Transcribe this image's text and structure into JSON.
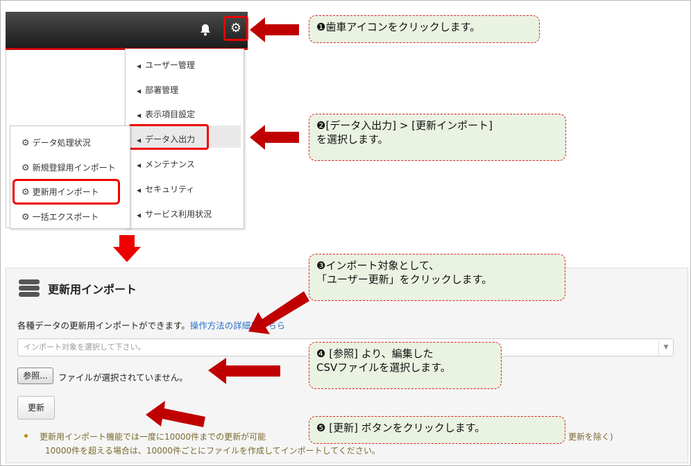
{
  "menu": {
    "items": [
      "ユーザー管理",
      "部署管理",
      "表示項目設定",
      "データ入出力",
      "メンテナンス",
      "セキュリティ",
      "サービス利用状況"
    ]
  },
  "submenu": {
    "items": [
      "データ処理状況",
      "新規登録用インポート",
      "更新用インポート",
      "一括エクスポート"
    ]
  },
  "callouts": {
    "c1": "❶歯車アイコンをクリックします。",
    "c2_line1": "❷[データ入出力] > [更新インポート]",
    "c2_line2": "を選択します。",
    "c3_line1": "❸インポート対象として、",
    "c3_line2": "「ユーザー更新」をクリックします。",
    "c4_line1": "❹ [参照] より、編集した",
    "c4_line2": "CSVファイルを選択します。",
    "c5": "❺ [更新] ボタンをクリックします。"
  },
  "panel": {
    "title": "更新用インポート",
    "desc": "各種データの更新用インポートができます。",
    "link": "操作方法の詳細はこちら",
    "select_placeholder": "インポート対象を選択して下さい。",
    "browse_label": "参照...",
    "no_file": "ファイルが選択されていません。",
    "update_label": "更新",
    "note_line1_a": "更新用インポート機能では一度に10000件までの更新が可能",
    "note_line1_b": "更新を除く)",
    "note_line2": "10000件を超える場合は、10000件ごとにファイルを作成してインポートしてください。"
  },
  "colors": {
    "accent_red": "#c00000",
    "callout_bg": "#eaf3e2",
    "link": "#2a6fc9"
  },
  "icons": {
    "bell": "bell-icon",
    "gear": "gear-icon",
    "database": "database-icon"
  }
}
